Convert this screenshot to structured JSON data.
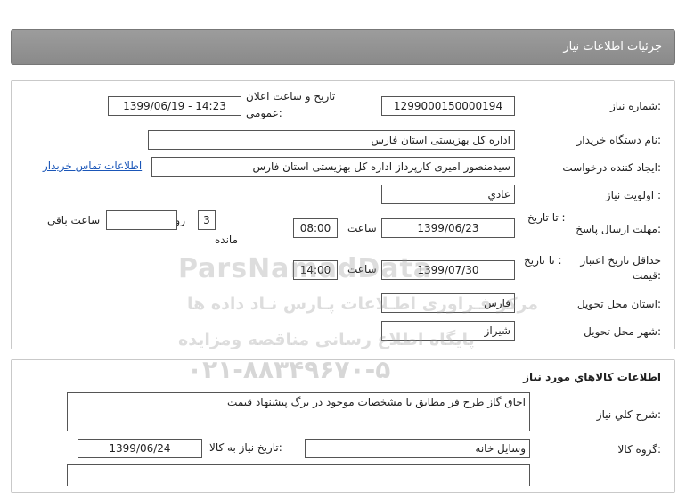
{
  "page": {
    "title": "جزئیات اطلاعات نیاز"
  },
  "need": {
    "number_label": "شماره نیاز:",
    "number_value": "1299000150000194",
    "announce_label_line1": "تاریخ و ساعت اعلان",
    "announce_label_line2": "عمومی:",
    "announce_value": "1399/06/19 - 14:23",
    "buyer_label": "نام دستگاه خریدار:",
    "buyer_value": "اداره کل بهزیستی استان فارس",
    "creator_label": "ایجاد کننده درخواست:",
    "creator_value": "سیدمنصور امیری کارپرداز اداره کل بهزیستی استان فارس",
    "contact_link": "اطلاعات تماس خریدار",
    "priority_label": "اولویت نیاز :",
    "priority_value": "عادي",
    "deadline_label": "مهلت ارسال پاسخ:",
    "deadline_to": "تا تاریخ :",
    "deadline_date": "1399/06/23",
    "deadline_time_label": "ساعت",
    "deadline_time": "08:00",
    "remaining_days": "3",
    "remaining_days_label": "روز و",
    "remaining_hours": "",
    "remaining_hours_label": "ساعت باقی",
    "remaining_suffix": "مانده",
    "validity_label_line1": "حداقل تاریخ اعتبار",
    "validity_label_line2": "قیمت:",
    "validity_to": "تا تاریخ :",
    "validity_date": "1399/07/30",
    "validity_time_label": "ساعت",
    "validity_time": "14:00",
    "province_label": "استان محل تحویل:",
    "province_value": "فارس",
    "city_label": "شهر محل تحویل:",
    "city_value": "شیراز"
  },
  "goods": {
    "section_title": "اطلاعات کالاهاي مورد نياز",
    "desc_label": "شرح کلي نياز:",
    "desc_value": "اجاق گاز طرح فر مطابق با مشخصات موجود در برگ پیشنهاد قیمت",
    "group_label": "گروه کالا:",
    "group_value": "وسايل خانه",
    "need_date_label": "تاریخ نیاز به کالا:",
    "need_date_value": "1399/06/24"
  },
  "watermark": {
    "brand": "ParsNamadData",
    "line1": "مرکز فـراوری اطـلاعات پـارس نـاد داده ها",
    "line2": "پایگاه اطلاع رسانی مناقصه ومزایده",
    "phone": "۰۲۱-۸۸۳۴۹۶۷۰-۵"
  }
}
